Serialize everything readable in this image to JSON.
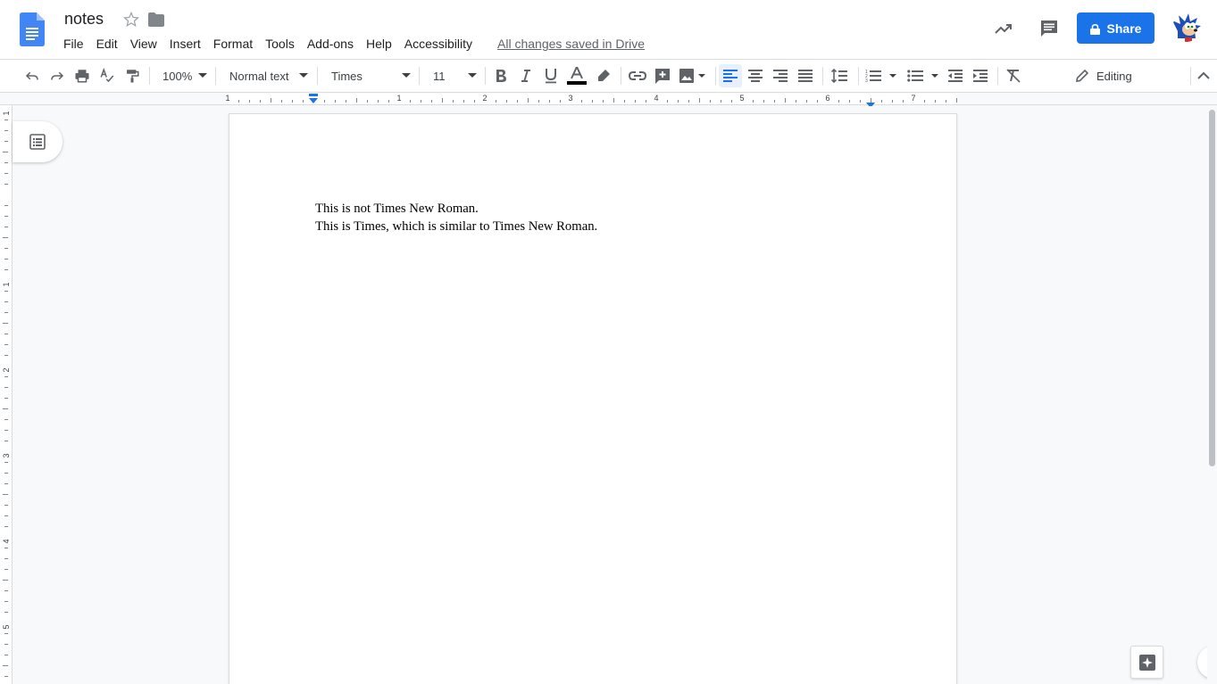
{
  "document": {
    "title": "notes",
    "save_status": "All changes saved in Drive",
    "lines": [
      "This is not Times New Roman.",
      "This is Times, which is similar to Times New Roman."
    ]
  },
  "menu": {
    "items": [
      {
        "label": "File"
      },
      {
        "label": "Edit"
      },
      {
        "label": "View"
      },
      {
        "label": "Insert"
      },
      {
        "label": "Format"
      },
      {
        "label": "Tools"
      },
      {
        "label": "Add-ons"
      },
      {
        "label": "Help"
      },
      {
        "label": "Accessibility"
      }
    ]
  },
  "header": {
    "share_label": "Share"
  },
  "toolbar": {
    "zoom": "100%",
    "paragraph_style": "Normal text",
    "font": "Times",
    "font_size": "11",
    "editing_mode": "Editing",
    "text_color": "#000000",
    "active_alignment": "left"
  },
  "rulers": {
    "horizontal_labels": [
      "1",
      "1",
      "2",
      "3",
      "4",
      "5",
      "6",
      "7"
    ],
    "vertical_labels": [
      "1",
      "1",
      "2",
      "3",
      "4",
      "5"
    ]
  },
  "colors": {
    "accent": "#1a73e8",
    "docs_blue": "#4285f4"
  },
  "icons": {
    "header": [
      "docs-logo-icon",
      "star-icon",
      "folder-icon",
      "activity-trend-icon",
      "comment-icon",
      "lock-icon"
    ],
    "toolbar": [
      "undo-icon",
      "redo-icon",
      "print-icon",
      "spellcheck-icon",
      "paint-format-icon",
      "bold-icon",
      "italic-icon",
      "underline-icon",
      "text-color-icon",
      "highlight-icon",
      "link-icon",
      "add-comment-icon",
      "image-icon",
      "align-left-icon",
      "align-center-icon",
      "align-right-icon",
      "justify-icon",
      "line-spacing-icon",
      "numbered-list-icon",
      "bulleted-list-icon",
      "decrease-indent-icon",
      "increase-indent-icon",
      "clear-formatting-icon",
      "pencil-icon",
      "collapse-icon"
    ],
    "canvas": [
      "outline-icon",
      "explore-icon",
      "chevron-left-icon"
    ]
  }
}
